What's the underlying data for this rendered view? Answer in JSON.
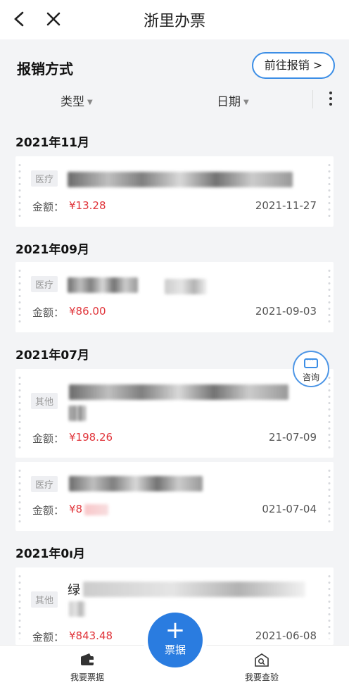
{
  "nav": {
    "title": "浙里办票"
  },
  "header": {
    "section_label": "报销方式",
    "goto_button": "前往报销 >",
    "filters": {
      "type": "类型",
      "date": "日期"
    }
  },
  "months": [
    {
      "label": "2021年11月"
    },
    {
      "label": "2021年09月"
    },
    {
      "label": "2021年07月"
    },
    {
      "label": "2021年0ı月"
    }
  ],
  "cards": [
    {
      "tag": "医疗",
      "amount_label": "金额：",
      "amount": "¥13.28",
      "date": "2021-11-27"
    },
    {
      "tag": "医疗",
      "amount_label": "金额：",
      "amount": "¥86.00",
      "date": "2021-09-03"
    },
    {
      "tag": "其他",
      "amount_label": "金额：",
      "amount": "¥198.26",
      "date": "21-07-09"
    },
    {
      "tag": "医疗",
      "amount_label": "金额：",
      "amount": "¥8",
      "date": "021-07-04"
    },
    {
      "tag": "其他",
      "title_prefix": "绿",
      "amount_label": "金额：",
      "amount": "¥843.48",
      "date": "2021-06-08"
    }
  ],
  "consult": {
    "label": "咨询"
  },
  "bottom_nav": {
    "tickets": "我要票据",
    "fab": "票据",
    "check": "我要查验"
  },
  "icons": [
    "back-arrow-icon",
    "close-icon",
    "more-vertical-icon",
    "chat-icon",
    "wallet-icon",
    "plus-icon",
    "verify-icon"
  ],
  "colors": {
    "accent": "#2a7ce0",
    "amount": "#e0343a"
  }
}
